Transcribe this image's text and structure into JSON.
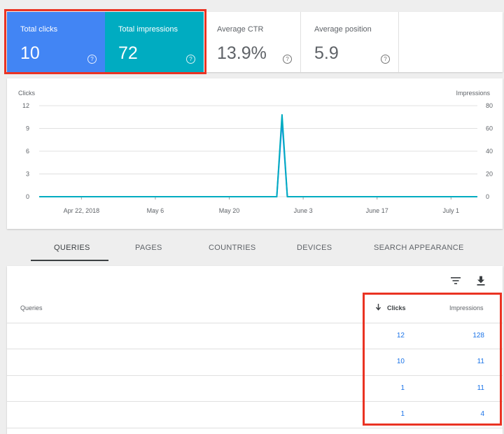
{
  "metrics": [
    {
      "label": "Total clicks",
      "value": "10",
      "help": "?"
    },
    {
      "label": "Total impressions",
      "value": "72",
      "help": "?"
    },
    {
      "label": "Average CTR",
      "value": "13.9%",
      "help": "?"
    },
    {
      "label": "Average position",
      "value": "5.9",
      "help": "?"
    }
  ],
  "colors": {
    "clicks": "#4285f4",
    "impressions": "#00acc1",
    "highlight": "#ea3323"
  },
  "chart_data": {
    "type": "line",
    "ylabel": "Clicks",
    "y2label": "Impressions",
    "yticks": [
      "12",
      "9",
      "6",
      "3",
      "0"
    ],
    "y2ticks": [
      "80",
      "60",
      "40",
      "20",
      "0"
    ],
    "ylim": [
      0,
      12
    ],
    "y2lim": [
      0,
      80
    ],
    "xticks": [
      "Apr 22, 2018",
      "May 6",
      "May 20",
      "June 3",
      "June 17",
      "July 1"
    ],
    "series": [
      {
        "name": "Clicks",
        "axis": "left",
        "color": "#4285f4",
        "x": [
          "2018-04-14",
          "2018-05-29",
          "2018-05-30",
          "2018-05-31",
          "2018-07-06"
        ],
        "y": [
          0,
          0,
          10,
          0,
          0
        ]
      },
      {
        "name": "Impressions",
        "axis": "right",
        "color": "#00acc1",
        "x": [
          "2018-04-14",
          "2018-05-29",
          "2018-05-30",
          "2018-05-31",
          "2018-07-06"
        ],
        "y": [
          0,
          0,
          72,
          0,
          0
        ]
      }
    ],
    "grid": true
  },
  "tabs": [
    "QUERIES",
    "PAGES",
    "COUNTRIES",
    "DEVICES",
    "SEARCH APPEARANCE"
  ],
  "table": {
    "columns": {
      "queries": "Queries",
      "clicks": "Clicks",
      "impressions": "Impressions"
    },
    "rows": [
      {
        "query": "",
        "clicks": "12",
        "impressions": "128"
      },
      {
        "query": "",
        "clicks": "10",
        "impressions": "11"
      },
      {
        "query": "",
        "clicks": "1",
        "impressions": "11"
      },
      {
        "query": "",
        "clicks": "1",
        "impressions": "4"
      }
    ]
  }
}
